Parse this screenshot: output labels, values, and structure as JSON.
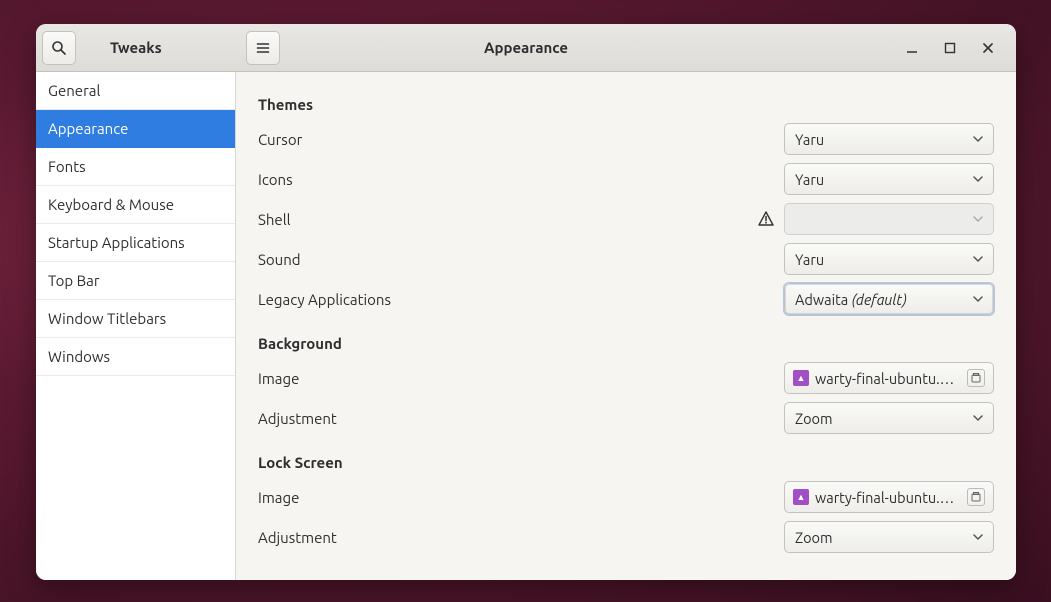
{
  "app": {
    "title": "Tweaks",
    "headerTitle": "Appearance"
  },
  "sidebar": {
    "items": [
      {
        "label": "General",
        "selected": false
      },
      {
        "label": "Appearance",
        "selected": true
      },
      {
        "label": "Fonts",
        "selected": false
      },
      {
        "label": "Keyboard & Mouse",
        "selected": false
      },
      {
        "label": "Startup Applications",
        "selected": false
      },
      {
        "label": "Top Bar",
        "selected": false
      },
      {
        "label": "Window Titlebars",
        "selected": false
      },
      {
        "label": "Windows",
        "selected": false
      }
    ]
  },
  "sections": {
    "themes": {
      "title": "Themes",
      "cursor": {
        "label": "Cursor",
        "value": "Yaru"
      },
      "icons": {
        "label": "Icons",
        "value": "Yaru"
      },
      "shell": {
        "label": "Shell",
        "value": "",
        "warning": true,
        "disabled": true
      },
      "sound": {
        "label": "Sound",
        "value": "Yaru"
      },
      "legacy": {
        "label": "Legacy Applications",
        "valuePrefix": "Adwaita ",
        "valueSuffix": "(default)",
        "focus": true
      }
    },
    "background": {
      "title": "Background",
      "image": {
        "label": "Image",
        "value": "warty-final-ubuntu.png"
      },
      "adjustment": {
        "label": "Adjustment",
        "value": "Zoom"
      }
    },
    "lockscreen": {
      "title": "Lock Screen",
      "image": {
        "label": "Image",
        "value": "warty-final-ubuntu.png"
      },
      "adjustment": {
        "label": "Adjustment",
        "value": "Zoom"
      }
    }
  }
}
